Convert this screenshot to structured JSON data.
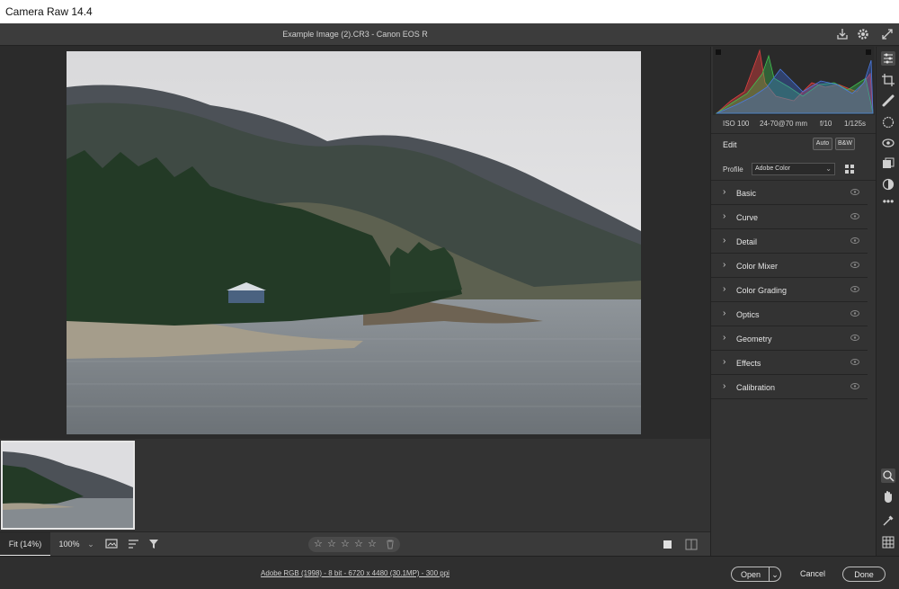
{
  "window": {
    "title": "Camera Raw 14.4"
  },
  "file": {
    "name": "Example Image (2).CR3  -  Canon EOS R"
  },
  "exif": {
    "iso": "ISO 100",
    "lens": "24-70@70 mm",
    "aperture": "f/10",
    "shutter": "1/125s"
  },
  "edit": {
    "label": "Edit",
    "auto_label": "Auto",
    "bw_label": "B&W"
  },
  "profile": {
    "label": "Profile",
    "value": "Adobe Color"
  },
  "sections": [
    {
      "label": "Basic"
    },
    {
      "label": "Curve"
    },
    {
      "label": "Detail"
    },
    {
      "label": "Color Mixer"
    },
    {
      "label": "Color Grading"
    },
    {
      "label": "Optics"
    },
    {
      "label": "Geometry"
    },
    {
      "label": "Effects"
    },
    {
      "label": "Calibration"
    }
  ],
  "zoom": {
    "fit_label": "Fit (14%)",
    "percent_label": "100%"
  },
  "rating": {
    "stars": 0,
    "max": 5
  },
  "footer": {
    "workflow_info": "Adobe RGB (1998) - 8 bit - 6720 x 4480 (30.1MP) - 300 ppi",
    "open_label": "Open",
    "cancel_label": "Cancel",
    "done_label": "Done"
  },
  "icons": {
    "top": [
      "save-icon",
      "settings-gear-icon",
      "fullscreen-icon"
    ],
    "right_tools": [
      "edit-sliders-icon",
      "crop-icon",
      "healing-icon",
      "masking-icon",
      "red-eye-icon",
      "snapshots-icon",
      "presets-icon",
      "more-icon",
      "zoom-icon",
      "hand-icon",
      "color-sampler-icon",
      "grid-icon"
    ]
  },
  "colors": {
    "accent": "#e6e6e6",
    "panel": "#333333",
    "background": "#2b2b2b"
  }
}
